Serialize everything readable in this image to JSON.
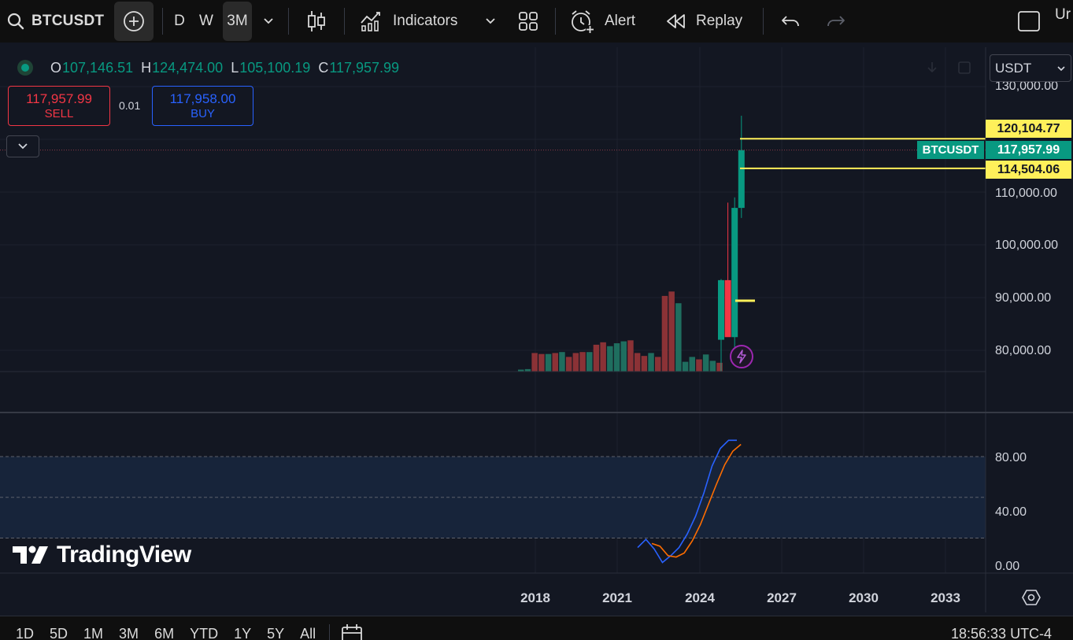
{
  "toolbar": {
    "symbol": "BTCUSDT",
    "intervals": [
      "D",
      "W",
      "3M"
    ],
    "active_interval": "3M",
    "indicators_label": "Indicators",
    "alert_label": "Alert",
    "replay_label": "Replay",
    "layout_label": "Ur"
  },
  "legend": {
    "open_key": "O",
    "open": "107,146.51",
    "high_key": "H",
    "high": "124,474.00",
    "low_key": "L",
    "low": "105,100.19",
    "close_key": "C",
    "close": "117,957.99"
  },
  "trade": {
    "sell_price": "117,957.99",
    "sell_label": "SELL",
    "spread": "0.01",
    "buy_price": "117,958.00",
    "buy_label": "BUY"
  },
  "price_axis": {
    "currency": "USDT",
    "labels": [
      "130,000.00",
      "110,000.00",
      "100,000.00",
      "90,000.00",
      "80,000.00"
    ],
    "tag_high": "120,104.77",
    "tag_last": "117,957.99",
    "tag_low": "114,504.06",
    "tag_symbol": "BTCUSDT"
  },
  "oscillator_axis": {
    "labels": [
      "80.00",
      "40.00",
      "0.00"
    ]
  },
  "time_axis": {
    "labels": [
      "2018",
      "2021",
      "2024",
      "2027",
      "2030",
      "2033"
    ]
  },
  "watermark": "TradingView",
  "bottom_bar": {
    "ranges": [
      "1D",
      "5D",
      "1M",
      "3M",
      "6M",
      "YTD",
      "1Y",
      "5Y",
      "All"
    ],
    "clock": "18:56:33 UTC-4"
  },
  "colors": {
    "up": "#089981",
    "down": "#f23645",
    "highlight": "#fff05a",
    "k_line": "#2962ff",
    "d_line": "#ff6d00"
  },
  "chart_data": {
    "type": "candlestick",
    "price_range": [
      76000,
      130000
    ],
    "last_price": 117957.99,
    "highlight_levels": [
      120104.77,
      114504.06
    ],
    "candles": [
      {
        "o": 82000,
        "h": 93500,
        "l": 76000,
        "c": 93300
      },
      {
        "o": 93300,
        "h": 108000,
        "l": 90000,
        "c": 82500
      },
      {
        "o": 82500,
        "h": 109000,
        "l": 80000,
        "c": 107000
      },
      {
        "o": 107000,
        "h": 124474,
        "l": 105100.19,
        "c": 117957.99
      }
    ],
    "volume_relative": [
      0.04,
      0.05,
      0.38,
      0.36,
      0.36,
      0.38,
      0.4,
      0.3,
      0.38,
      0.4,
      0.4,
      0.55,
      0.6,
      0.52,
      0.58,
      0.62,
      0.64,
      0.38,
      0.32,
      0.38,
      0.3,
      1.55,
      1.64,
      1.4,
      0.2,
      0.3,
      0.25,
      0.35,
      0.22,
      0.18
    ],
    "volume_up": [
      1,
      1,
      0,
      0,
      1,
      0,
      1,
      0,
      0,
      0,
      1,
      0,
      0,
      1,
      1,
      1,
      0,
      0,
      0,
      1,
      0,
      0,
      0,
      1,
      1,
      1,
      0,
      1,
      1,
      0
    ],
    "oscillator": {
      "ylim": [
        0,
        100
      ],
      "bands": [
        20,
        50,
        80
      ],
      "k": [
        13,
        19,
        12,
        2,
        7,
        13,
        23,
        36,
        53,
        73,
        86,
        92,
        92
      ],
      "d": [
        16,
        14,
        7,
        6,
        9,
        18,
        30,
        45,
        60,
        74,
        84,
        89
      ]
    }
  }
}
